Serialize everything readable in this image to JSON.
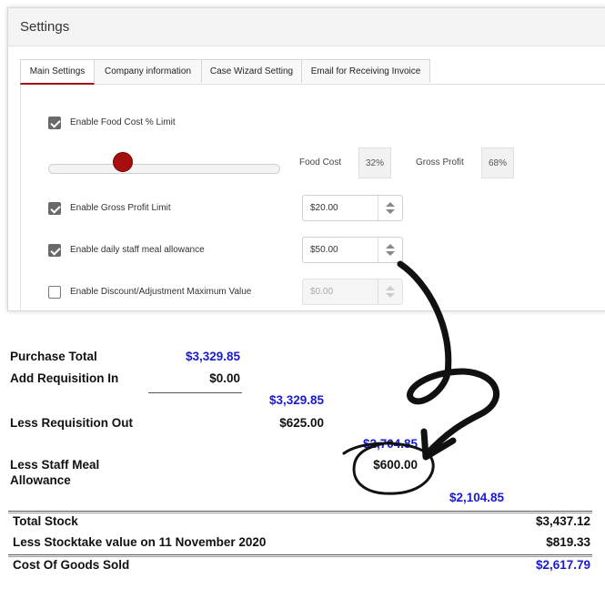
{
  "settings": {
    "title": "Settings",
    "tabs": [
      {
        "label": "Main Settings"
      },
      {
        "label": "Company information"
      },
      {
        "label": "Case Wizard Setting"
      },
      {
        "label": "Email for Receiving Invoice"
      }
    ],
    "food_cost_limit": {
      "label": "Enable Food Cost % Limit",
      "checked": true
    },
    "slider": {
      "value_percent": 32
    },
    "food_cost": {
      "label": "Food Cost",
      "value": "32%"
    },
    "gross_profit": {
      "label": "Gross Profit",
      "value": "68%"
    },
    "gross_profit_limit": {
      "label": "Enable Gross Profit Limit",
      "checked": true,
      "value": "$20.00"
    },
    "staff_meal": {
      "label": "Enable daily staff meal allowance",
      "checked": true,
      "value": "$50.00"
    },
    "discount_max": {
      "label": "Enable Discount/Adjustment Maximum Value",
      "checked": false,
      "placeholder": "$0.00"
    }
  },
  "report": {
    "purchase_total": {
      "label": "Purchase Total",
      "value": "$3,329.85"
    },
    "add_requisition_in": {
      "label": "Add Requisition In",
      "value": "$0.00"
    },
    "subtotal_1": "$3,329.85",
    "less_requisition_out": {
      "label": "Less Requisition Out",
      "value": "$625.00"
    },
    "subtotal_2": "$2,704.85",
    "less_staff_meal": {
      "label_line1": "Less Staff Meal",
      "label_line2": "Allowance",
      "value": "$600.00"
    },
    "subtotal_3": "$2,104.85",
    "total_stock": {
      "label": "Total Stock",
      "value": "$3,437.12"
    },
    "less_stocktake": {
      "label": "Less Stocktake value on 11 November 2020",
      "value": "$819.33"
    },
    "cost_of_goods_sold": {
      "label": "Cost Of Goods Sold",
      "value": "$2,617.79"
    }
  },
  "colors": {
    "accent": "#a60f0f",
    "report_blue": "#1a1ad0"
  }
}
